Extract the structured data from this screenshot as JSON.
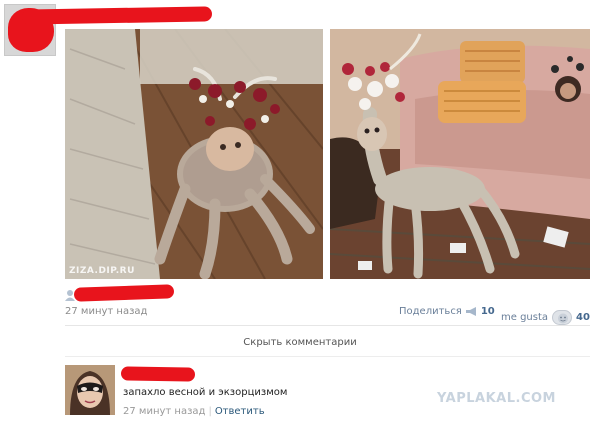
{
  "post": {
    "photo_watermark": "ZIZA.DIP.RU",
    "time": "27 минут назад",
    "share_label": "Поделиться",
    "share_count": "10",
    "like_label": "me gusta",
    "like_count": "40",
    "hide_comments_label": "Скрыть комментарии"
  },
  "comment": {
    "text": "запахло весной и экзорцизмом",
    "time": "27 минут назад",
    "reply_label": "Ответить"
  },
  "site_watermark": "YAPLAKAL.COM",
  "colors": {
    "redaction": "#e8141c",
    "link": "#45688e",
    "meta_text": "#8b8b8b"
  }
}
